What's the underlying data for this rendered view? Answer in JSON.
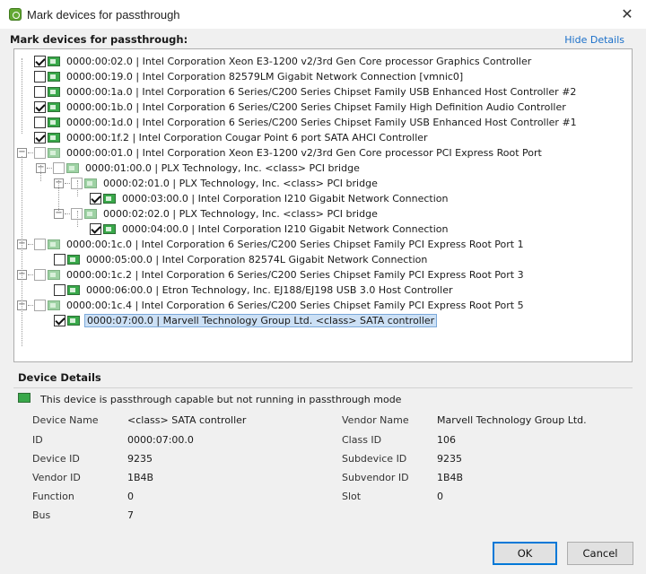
{
  "window": {
    "title": "Mark devices for passthrough",
    "close_glyph": "✕"
  },
  "section": {
    "heading": "Mark devices for passthrough:",
    "hide_details": "Hide Details"
  },
  "tree": [
    {
      "label": "0000:00:02.0 | Intel Corporation Xeon E3-1200 v2/3rd Gen Core processor Graphics Controller",
      "checked": true,
      "enabled": true
    },
    {
      "label": "0000:00:19.0 | Intel Corporation 82579LM Gigabit Network Connection [vmnic0]",
      "checked": false,
      "enabled": true
    },
    {
      "label": "0000:00:1a.0 | Intel Corporation 6 Series/C200 Series Chipset Family USB Enhanced Host Controller #2",
      "checked": false,
      "enabled": true
    },
    {
      "label": "0000:00:1b.0 | Intel Corporation 6 Series/C200 Series Chipset Family High Definition Audio Controller",
      "checked": true,
      "enabled": true
    },
    {
      "label": "0000:00:1d.0 | Intel Corporation 6 Series/C200 Series Chipset Family USB Enhanced Host Controller #1",
      "checked": false,
      "enabled": true
    },
    {
      "label": "0000:00:1f.2 | Intel Corporation Cougar Point 6 port SATA AHCI Controller",
      "checked": true,
      "enabled": true
    },
    {
      "label": "0000:00:01.0 | Intel Corporation Xeon E3-1200 v2/3rd Gen Core processor PCI Express Root Port",
      "checked": false,
      "enabled": false,
      "expander": "−"
    },
    {
      "label": "0000:01:00.0 | PLX Technology, Inc. <class> PCI bridge",
      "checked": false,
      "enabled": false,
      "expander": "−"
    },
    {
      "label": "0000:02:01.0 | PLX Technology, Inc. <class> PCI bridge",
      "checked": false,
      "enabled": false,
      "expander": "−"
    },
    {
      "label": "0000:03:00.0 | Intel Corporation I210 Gigabit Network Connection",
      "checked": true,
      "enabled": true
    },
    {
      "label": "0000:02:02.0 | PLX Technology, Inc. <class> PCI bridge",
      "checked": false,
      "enabled": false,
      "expander": "−"
    },
    {
      "label": "0000:04:00.0 | Intel Corporation I210 Gigabit Network Connection",
      "checked": true,
      "enabled": true
    },
    {
      "label": "0000:00:1c.0 | Intel Corporation 6 Series/C200 Series Chipset Family PCI Express Root Port 1",
      "checked": false,
      "enabled": false,
      "expander": "−"
    },
    {
      "label": "0000:05:00.0 | Intel Corporation 82574L Gigabit Network Connection",
      "checked": false,
      "enabled": true
    },
    {
      "label": "0000:00:1c.2 | Intel Corporation 6 Series/C200 Series Chipset Family PCI Express Root Port 3",
      "checked": false,
      "enabled": false,
      "expander": "−"
    },
    {
      "label": "0000:06:00.0 | Etron Technology, Inc. EJ188/EJ198 USB 3.0 Host Controller",
      "checked": false,
      "enabled": true
    },
    {
      "label": "0000:00:1c.4 | Intel Corporation 6 Series/C200 Series Chipset Family PCI Express Root Port 5",
      "checked": false,
      "enabled": false,
      "expander": "−"
    },
    {
      "label": "0000:07:00.0 | Marvell Technology Group Ltd. <class> SATA controller",
      "checked": true,
      "enabled": true,
      "selected": true
    }
  ],
  "details": {
    "heading": "Device Details",
    "status": "This device is passthrough capable but not running in passthrough mode",
    "left": [
      {
        "label": "Device Name",
        "value": "<class> SATA controller"
      },
      {
        "label": "ID",
        "value": "0000:07:00.0"
      },
      {
        "label": "Device ID",
        "value": "9235"
      },
      {
        "label": "Vendor ID",
        "value": "1B4B"
      },
      {
        "label": "Function",
        "value": "0"
      },
      {
        "label": "Bus",
        "value": "7"
      }
    ],
    "right": [
      {
        "label": "Vendor Name",
        "value": "Marvell Technology Group Ltd."
      },
      {
        "label": "Class ID",
        "value": "106"
      },
      {
        "label": "Subdevice ID",
        "value": "9235"
      },
      {
        "label": "Subvendor ID",
        "value": "1B4B"
      },
      {
        "label": "Slot",
        "value": "0"
      }
    ]
  },
  "buttons": {
    "ok": "OK",
    "cancel": "Cancel"
  }
}
